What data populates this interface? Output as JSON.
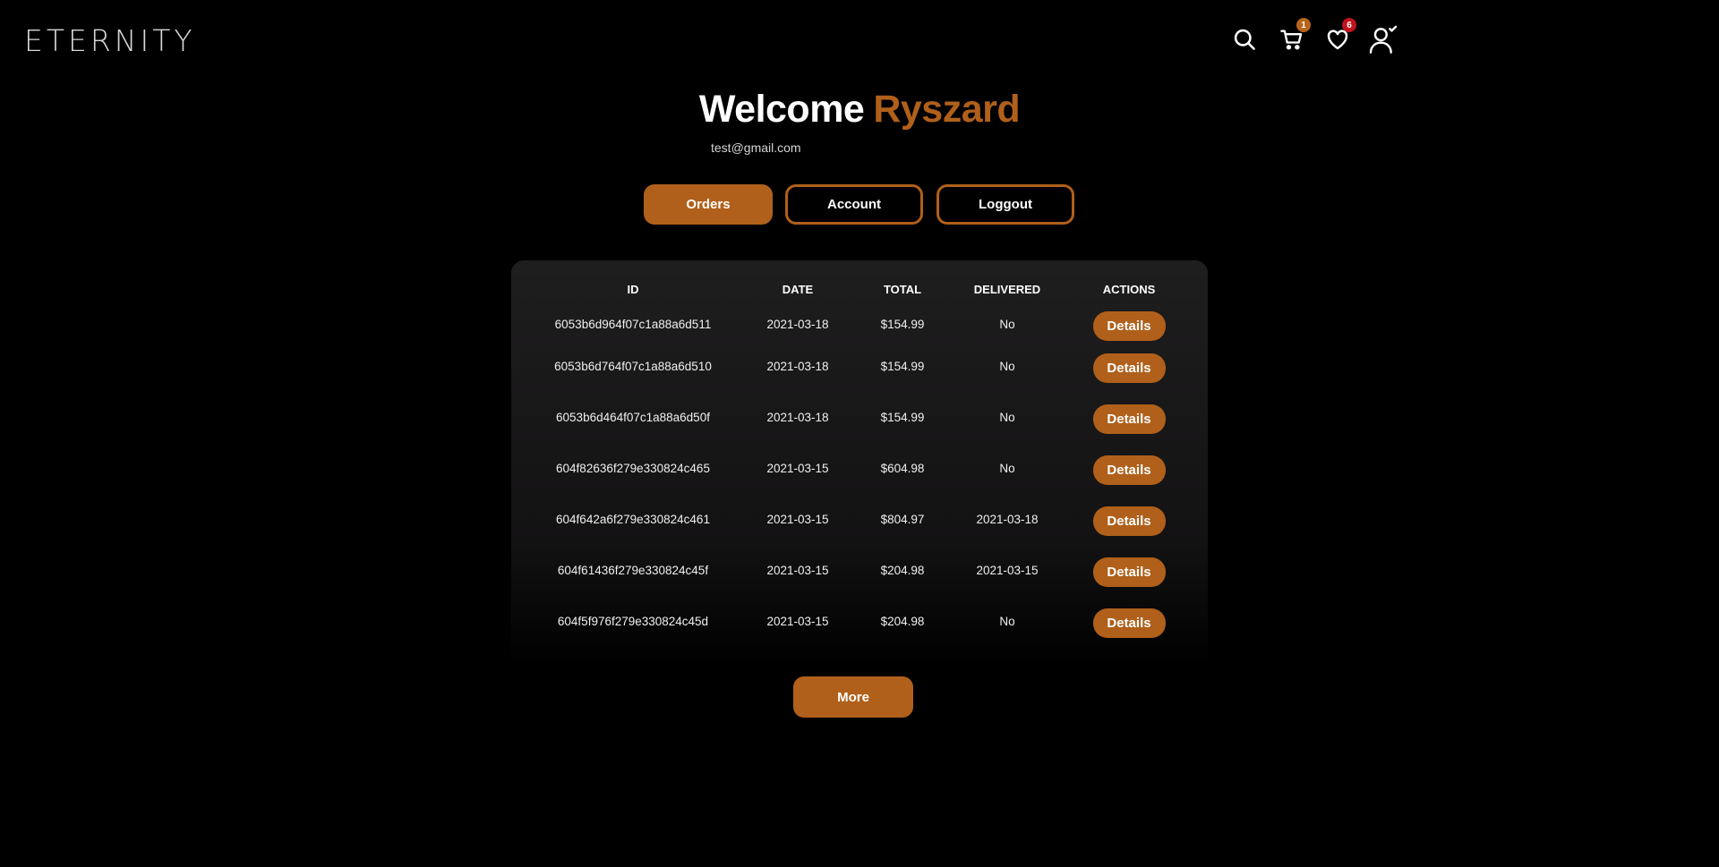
{
  "brand": {
    "logo": "ETERNITY"
  },
  "colors": {
    "accent": "#b0601a",
    "badge_cart": "#b8641a",
    "badge_wishlist": "#c1141d"
  },
  "nav": {
    "search_icon": "search-icon",
    "cart_icon": "cart-icon",
    "cart_count": "1",
    "wishlist_icon": "heart-icon",
    "wishlist_count": "6",
    "user_icon": "user-check-icon"
  },
  "hero": {
    "welcome": "Welcome",
    "name": "Ryszard",
    "email": "test@gmail.com"
  },
  "tabs": {
    "orders": "Orders",
    "account": "Account",
    "logout": "Loggout"
  },
  "orders_table": {
    "headers": {
      "id": "ID",
      "date": "DATE",
      "total": "TOTAL",
      "delivered": "DELIVERED",
      "actions": "ACTIONS"
    },
    "rows": [
      {
        "id": "6053b6d964f07c1a88a6d511",
        "date": "2021-03-18",
        "total": "$154.99",
        "delivered": "No",
        "action": "Details"
      },
      {
        "id": "6053b6d764f07c1a88a6d510",
        "date": "2021-03-18",
        "total": "$154.99",
        "delivered": "No",
        "action": "Details"
      },
      {
        "id": "6053b6d464f07c1a88a6d50f",
        "date": "2021-03-18",
        "total": "$154.99",
        "delivered": "No",
        "action": "Details"
      },
      {
        "id": "604f82636f279e330824c465",
        "date": "2021-03-15",
        "total": "$604.98",
        "delivered": "No",
        "action": "Details"
      },
      {
        "id": "604f642a6f279e330824c461",
        "date": "2021-03-15",
        "total": "$804.97",
        "delivered": "2021-03-18",
        "action": "Details"
      },
      {
        "id": "604f61436f279e330824c45f",
        "date": "2021-03-15",
        "total": "$204.98",
        "delivered": "2021-03-15",
        "action": "Details"
      },
      {
        "id": "604f5f976f279e330824c45d",
        "date": "2021-03-15",
        "total": "$204.98",
        "delivered": "No",
        "action": "Details"
      }
    ]
  },
  "more_button": "More"
}
